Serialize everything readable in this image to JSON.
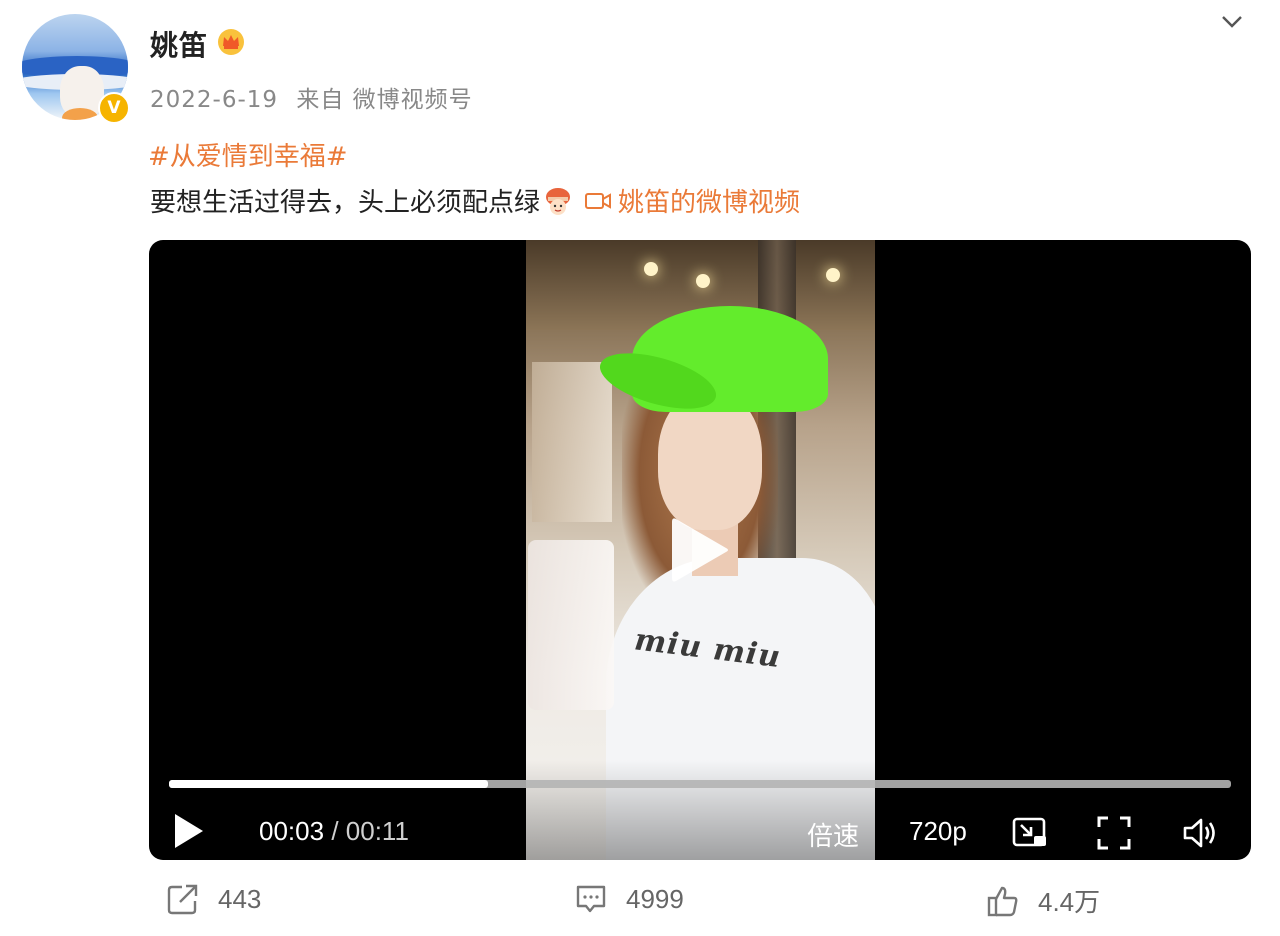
{
  "post": {
    "username": "姚笛",
    "date": "2022-6-19",
    "source": "来自 微博视频号",
    "topic": "#从爱情到幸福#",
    "text": "要想生活过得去，头上必须配点绿",
    "video_link_label": "姚笛的微博视频",
    "icons": {
      "avatar": "avatar",
      "verified": "verified-badge-icon",
      "crown": "crown-icon",
      "menu": "chevron-down-icon",
      "emoji": "emoji-icon",
      "video_link": "video-camera-icon"
    },
    "accent_color": "#ea7a38"
  },
  "video": {
    "current_time": "00:03",
    "separator": "/",
    "total_time": "00:11",
    "progress_fraction": 0.3,
    "speed_label": "倍速",
    "quality_label": "720p",
    "shirt_text": "miu miu",
    "icons": [
      "play-icon",
      "picture-in-picture-icon",
      "fullscreen-icon",
      "volume-icon"
    ]
  },
  "actions": {
    "share_count": "443",
    "comment_count": "4999",
    "like_count": "4.4万"
  }
}
